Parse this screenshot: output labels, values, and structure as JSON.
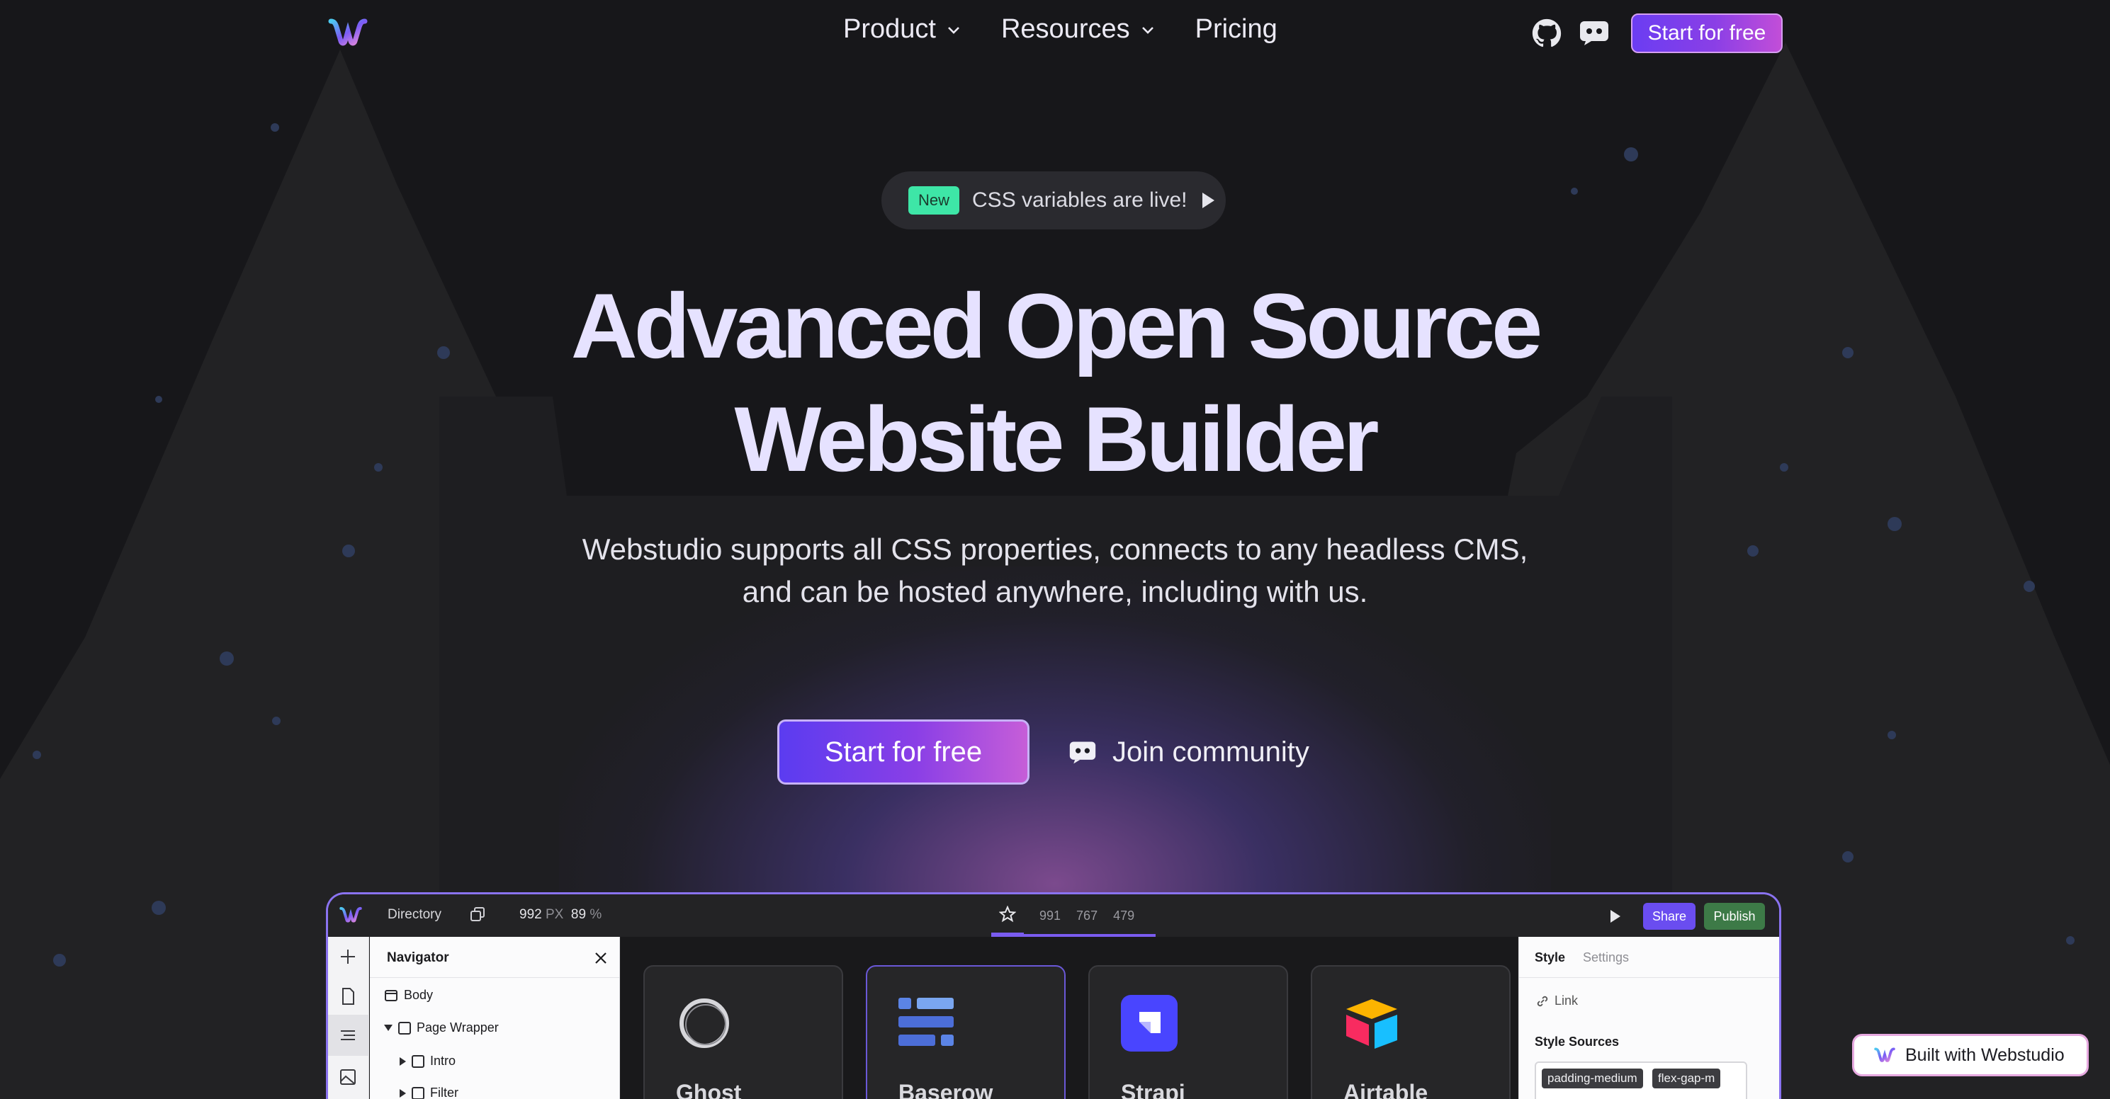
{
  "header": {
    "nav": [
      {
        "label": "Product",
        "has_dropdown": true
      },
      {
        "label": "Resources",
        "has_dropdown": true
      },
      {
        "label": "Pricing",
        "has_dropdown": false
      }
    ],
    "cta_label": "Start for free",
    "icons": [
      "webstudio-logo-icon",
      "github-icon",
      "discord-icon"
    ]
  },
  "announcement": {
    "badge": "New",
    "text": "CSS variables are live!"
  },
  "hero": {
    "title_line1": "Advanced Open Source",
    "title_line2": "Website Builder",
    "subtitle_line1": "Webstudio supports all CSS properties, connects to any headless CMS,",
    "subtitle_line2": "and can be hosted anywhere, including with us.",
    "primary_cta": "Start for free",
    "secondary_cta": "Join community"
  },
  "app_preview": {
    "topbar": {
      "page_name": "Directory",
      "width_value": "992",
      "width_unit": "PX",
      "zoom_value": "89",
      "zoom_unit": "%",
      "breakpoints": [
        "991",
        "767",
        "479"
      ],
      "share_label": "Share",
      "publish_label": "Publish"
    },
    "navigator": {
      "title": "Navigator",
      "tree": [
        "Body",
        "Page Wrapper",
        "Intro",
        "Filter"
      ]
    },
    "cards": [
      {
        "name": "Ghost"
      },
      {
        "name": "Baserow"
      },
      {
        "name": "Strapi"
      },
      {
        "name": "Airtable"
      }
    ],
    "style_panel": {
      "tabs": [
        "Style",
        "Settings"
      ],
      "link_label": "Link",
      "sources_label": "Style Sources",
      "chips": [
        "padding-medium",
        "flex-gap-m"
      ]
    }
  },
  "built_badge": "Built with Webstudio",
  "colors": {
    "background": "#17171a",
    "accent_purple": "#6b3df2",
    "accent_pink": "#c24ed8",
    "new_badge": "#3ee6a7",
    "publish_green": "#3d7a47"
  }
}
